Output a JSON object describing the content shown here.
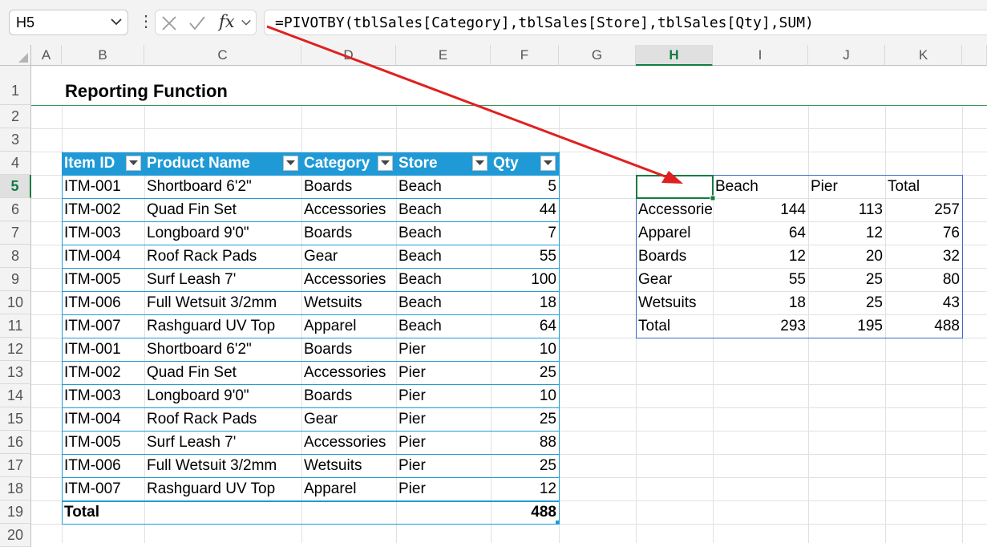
{
  "name_box": {
    "value": "H5"
  },
  "formula_bar": {
    "cancel_icon": "x-icon",
    "enter_icon": "check-icon",
    "function_icon_label": "fx",
    "formula": "=PIVOTBY(tblSales[Category],tblSales[Store],tblSales[Qty],SUM)"
  },
  "columns": [
    "A",
    "B",
    "C",
    "D",
    "E",
    "F",
    "G",
    "H",
    "I",
    "J",
    "K"
  ],
  "rows": [
    "1",
    "2",
    "3",
    "4",
    "5",
    "6",
    "7",
    "8",
    "9",
    "10",
    "11",
    "12",
    "13",
    "14",
    "15",
    "16",
    "17",
    "18",
    "19",
    "20"
  ],
  "selected_cell": {
    "column": "H",
    "row": "5"
  },
  "sheet": {
    "title": "Reporting Function"
  },
  "table": {
    "headers": [
      "Item ID",
      "Product Name",
      "Category",
      "Store",
      "Qty"
    ],
    "rows": [
      [
        "ITM-001",
        "Shortboard 6'2\"",
        "Boards",
        "Beach",
        "5"
      ],
      [
        "ITM-002",
        "Quad Fin Set",
        "Accessories",
        "Beach",
        "44"
      ],
      [
        "ITM-003",
        "Longboard 9'0\"",
        "Boards",
        "Beach",
        "7"
      ],
      [
        "ITM-004",
        "Roof Rack Pads",
        "Gear",
        "Beach",
        "55"
      ],
      [
        "ITM-005",
        "Surf Leash 7'",
        "Accessories",
        "Beach",
        "100"
      ],
      [
        "ITM-006",
        "Full Wetsuit 3/2mm",
        "Wetsuits",
        "Beach",
        "18"
      ],
      [
        "ITM-007",
        "Rashguard UV Top",
        "Apparel",
        "Beach",
        "64"
      ],
      [
        "ITM-001",
        "Shortboard 6'2\"",
        "Boards",
        "Pier",
        "10"
      ],
      [
        "ITM-002",
        "Quad Fin Set",
        "Accessories",
        "Pier",
        "25"
      ],
      [
        "ITM-003",
        "Longboard 9'0\"",
        "Boards",
        "Pier",
        "10"
      ],
      [
        "ITM-004",
        "Roof Rack Pads",
        "Gear",
        "Pier",
        "25"
      ],
      [
        "ITM-005",
        "Surf Leash 7'",
        "Accessories",
        "Pier",
        "88"
      ],
      [
        "ITM-006",
        "Full Wetsuit 3/2mm",
        "Wetsuits",
        "Pier",
        "25"
      ],
      [
        "ITM-007",
        "Rashguard UV Top",
        "Apparel",
        "Pier",
        "12"
      ]
    ],
    "total_label": "Total",
    "total_value": "488"
  },
  "pivot": {
    "headers": [
      "",
      "Beach",
      "Pier",
      "Total"
    ],
    "rows": [
      [
        "Accessories",
        "144",
        "113",
        "257"
      ],
      [
        "Apparel",
        "64",
        "12",
        "76"
      ],
      [
        "Boards",
        "12",
        "20",
        "32"
      ],
      [
        "Gear",
        "55",
        "25",
        "80"
      ],
      [
        "Wetsuits",
        "18",
        "25",
        "43"
      ],
      [
        "Total",
        "293",
        "195",
        "488"
      ]
    ]
  },
  "colors": {
    "table_header": "#1f9ad6",
    "table_border": "#1f9ad6",
    "selection": "#107c41",
    "arrow": "#e02020"
  }
}
